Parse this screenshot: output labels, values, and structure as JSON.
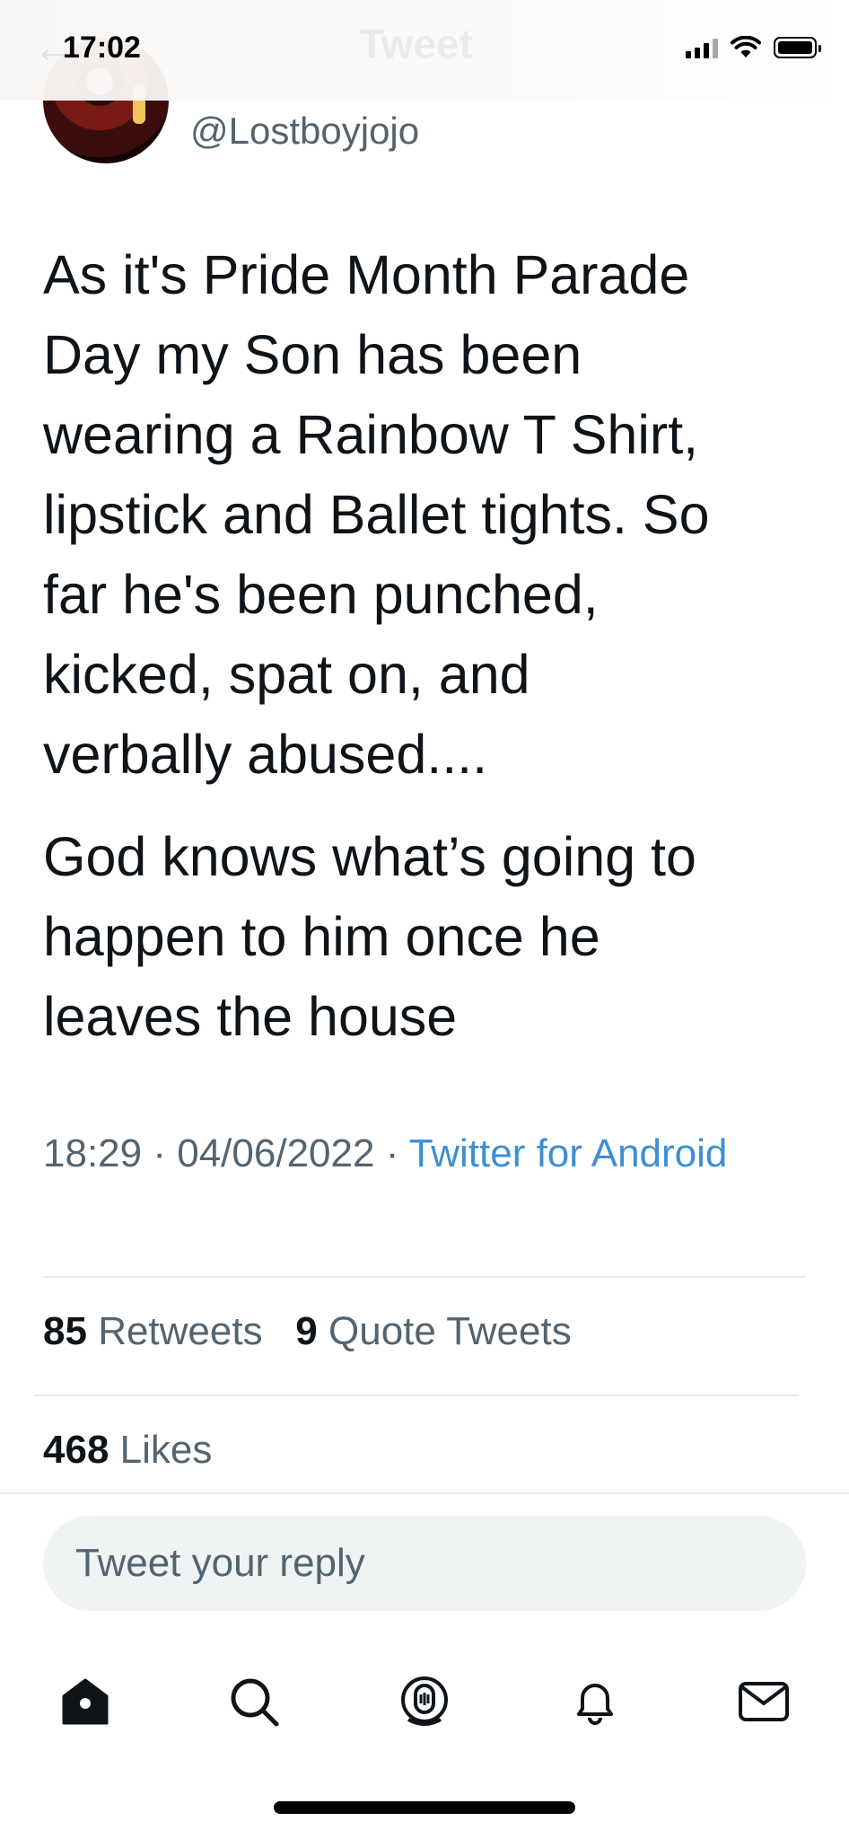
{
  "status_bar": {
    "time": "17:02"
  },
  "nav": {
    "title": "Tweet"
  },
  "author": {
    "handle": "@Lostboyjojo"
  },
  "tweet": {
    "paragraph1": "As it's Pride Month Parade\nDay my Son has been\nwearing a Rainbow T Shirt,\nlipstick and Ballet tights. So\nfar he's been punched,\nkicked, spat on, and\nverbally abused....",
    "paragraph2": "God knows what’s going to\nhappen to him once he\nleaves the house",
    "time": "18:29",
    "date": "04/06/2022",
    "separator": "·",
    "client": "Twitter for Android"
  },
  "stats": {
    "retweets_count": "85",
    "retweets_label": "Retweets",
    "quotes_count": "9",
    "quotes_label": "Quote Tweets",
    "likes_count": "468",
    "likes_label": "Likes"
  },
  "reply": {
    "placeholder": "Tweet your reply"
  },
  "tabbar": {
    "icons": [
      "home-icon",
      "search-icon",
      "spaces-icon",
      "notifications-icon",
      "messages-icon"
    ]
  },
  "colors": {
    "link": "#3d8fd3",
    "secondary_text": "#536471",
    "reply_bg": "#eff3f4"
  }
}
